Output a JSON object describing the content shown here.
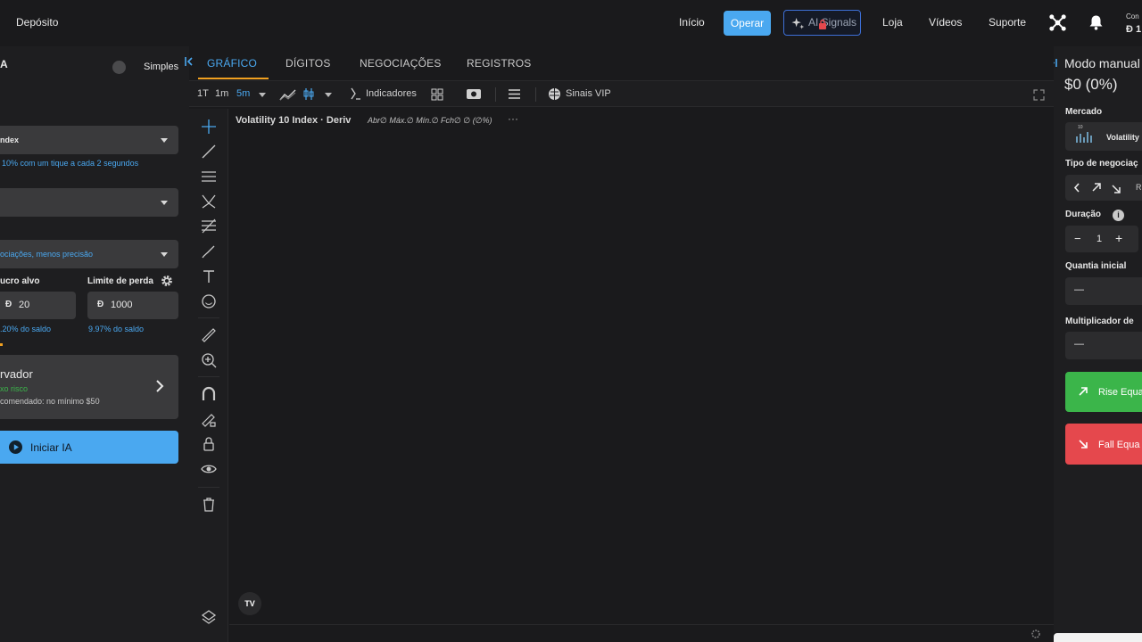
{
  "header": {
    "deposit": "Depósito",
    "nav": [
      "Início",
      "Operar",
      "AI Signals",
      "Loja",
      "Vídeos",
      "Suporte"
    ],
    "account_label": "Con",
    "account_balance": "Đ 1"
  },
  "left": {
    "title_fragment": "A",
    "mode_label": "Simples",
    "market_select": "ndex",
    "market_hint": "10% com um tique a cada 2 segundos",
    "strategy_select": "",
    "precision_select": "ociações, menos precisão",
    "profit_label": "ucro alvo",
    "loss_label": "Limite de perda",
    "currency": "Đ",
    "profit_value": "20",
    "loss_value": "1000",
    "profit_pct": ".20% do saldo",
    "loss_pct": "9.97% do saldo",
    "profile_title": "rvador",
    "profile_risk": "xo risco",
    "profile_note": "comendado: no mínimo $50",
    "start_label": "Iniciar IA"
  },
  "chart": {
    "tabs": [
      "GRÁFICO",
      "DÍGITOS",
      "NEGOCIAÇÕES",
      "REGISTROS"
    ],
    "intervals": [
      "1T",
      "1m",
      "5m"
    ],
    "indicators_label": "Indicadores",
    "vip_label": "Sinais VIP",
    "symbol_title": "Volatility 10 Index · Deriv",
    "ohlc": "Abr∅ Máx.∅ Mín.∅ Fch∅ ∅ (∅%)",
    "logo": "TV"
  },
  "right": {
    "title": "Modo manual",
    "pnl": "$0 (0%)",
    "market_label": "Mercado",
    "market_value": "Volatility",
    "market_badge": "10",
    "trade_type_label": "Tipo de negociaç",
    "trade_type_letter": "R",
    "duration_label": "Duração",
    "duration_value": "1",
    "amount_label": "Quantia inicial",
    "amount_value": "—",
    "multiplier_label": "Multiplicador de",
    "multiplier_value": "—",
    "rise_label": "Rise Equa",
    "fall_label": "Fall Equa"
  },
  "colors": {
    "accent": "#4aa8f0",
    "rise": "#3bb54a",
    "fall": "#e5484d",
    "background": "#1a1a1c",
    "panel": "#1e1e20"
  },
  "icons": [
    "network-icon",
    "bell-icon",
    "sparkle-icon",
    "gear-icon",
    "chevron-right-icon",
    "play-icon",
    "info-icon",
    "fullscreen-icon"
  ]
}
